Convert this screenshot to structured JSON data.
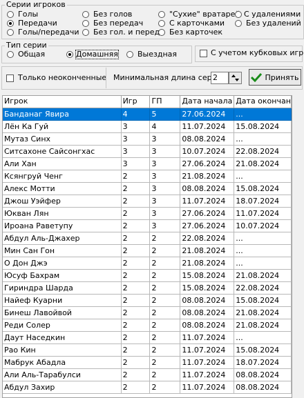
{
  "series_group": {
    "title": "Серии игроков",
    "options": [
      {
        "label": "Голы",
        "checked": false
      },
      {
        "label": "Передачи",
        "checked": true
      },
      {
        "label": "Голы/передачи",
        "checked": false
      },
      {
        "label": "Без голов",
        "checked": false
      },
      {
        "label": "Без передач",
        "checked": false
      },
      {
        "label": "Без гол. и перед.",
        "checked": false
      },
      {
        "label": "\"Сухие\" вратарей",
        "checked": false
      },
      {
        "label": "С карточками",
        "checked": false
      },
      {
        "label": "Без карточек",
        "checked": false
      },
      {
        "label": "С удалениями",
        "checked": false
      },
      {
        "label": "Без удалений",
        "checked": false
      }
    ]
  },
  "type_group": {
    "title": "Тип серии",
    "options": [
      {
        "label": "Общая",
        "checked": false
      },
      {
        "label": "Домашняя",
        "checked": true
      },
      {
        "label": "Выездная",
        "checked": false
      }
    ]
  },
  "cup_checkbox": {
    "label": "С учетом кубковых игр",
    "checked": false
  },
  "unfinished_checkbox": {
    "label": "Только неоконченные",
    "checked": false
  },
  "min_length": {
    "label": "Минимальная длина серии",
    "value": "2"
  },
  "accept_button": {
    "label": "Принять"
  },
  "table": {
    "columns": [
      "Игрок",
      "Игр",
      "ГП",
      "Дата начала",
      "Дата окончания"
    ],
    "rows": [
      [
        "Банданаг Явира",
        "4",
        "5",
        "27.06.2024",
        "..."
      ],
      [
        "Лён Ка Гуй",
        "3",
        "4",
        "11.07.2024",
        "15.08.2024"
      ],
      [
        "Мутаз Синх",
        "3",
        "3",
        "08.08.2024",
        "..."
      ],
      [
        "Ситсахоне Сайсонгхас",
        "3",
        "3",
        "10.07.2024",
        "22.08.2024"
      ],
      [
        "Али Хан",
        "3",
        "3",
        "27.06.2024",
        "21.08.2024"
      ],
      [
        "Ксянгруй Ченг",
        "2",
        "3",
        "21.08.2024",
        "..."
      ],
      [
        "Алекс Мотти",
        "2",
        "3",
        "08.08.2024",
        "15.08.2024"
      ],
      [
        "Джош Уэйфер",
        "2",
        "3",
        "11.07.2024",
        "18.07.2024"
      ],
      [
        "Юкван Лян",
        "2",
        "3",
        "27.06.2024",
        "11.07.2024"
      ],
      [
        "Ироана Раветупу",
        "2",
        "3",
        "27.06.2024",
        "10.07.2024"
      ],
      [
        "Абдул Аль-Джахер",
        "2",
        "2",
        "22.08.2024",
        "..."
      ],
      [
        "Мин Сан Гон",
        "2",
        "2",
        "21.08.2024",
        "..."
      ],
      [
        "О Дон Джэ",
        "2",
        "2",
        "21.08.2024",
        "..."
      ],
      [
        "Юсуф Бахрам",
        "2",
        "2",
        "15.08.2024",
        "21.08.2024"
      ],
      [
        "Гириндра Шарда",
        "2",
        "2",
        "15.08.2024",
        "22.08.2024"
      ],
      [
        "Найеф Куарни",
        "2",
        "2",
        "08.08.2024",
        "15.08.2024"
      ],
      [
        "Бинеш Лавойвой",
        "2",
        "2",
        "08.08.2024",
        "21.08.2024"
      ],
      [
        "Реди Солер",
        "2",
        "2",
        "08.08.2024",
        "21.08.2024"
      ],
      [
        "Даут Наседкин",
        "2",
        "2",
        "11.07.2024",
        "..."
      ],
      [
        "Рао Кин",
        "2",
        "2",
        "11.07.2024",
        "15.08.2024"
      ],
      [
        "Мабрук Абадла",
        "2",
        "2",
        "11.07.2024",
        "18.07.2024"
      ],
      [
        "Али Аль-Тарабулси",
        "2",
        "2",
        "11.07.2024",
        "08.08.2024"
      ],
      [
        "Абдул Захир",
        "2",
        "2",
        "11.07.2024",
        "08.08.2024"
      ]
    ]
  }
}
